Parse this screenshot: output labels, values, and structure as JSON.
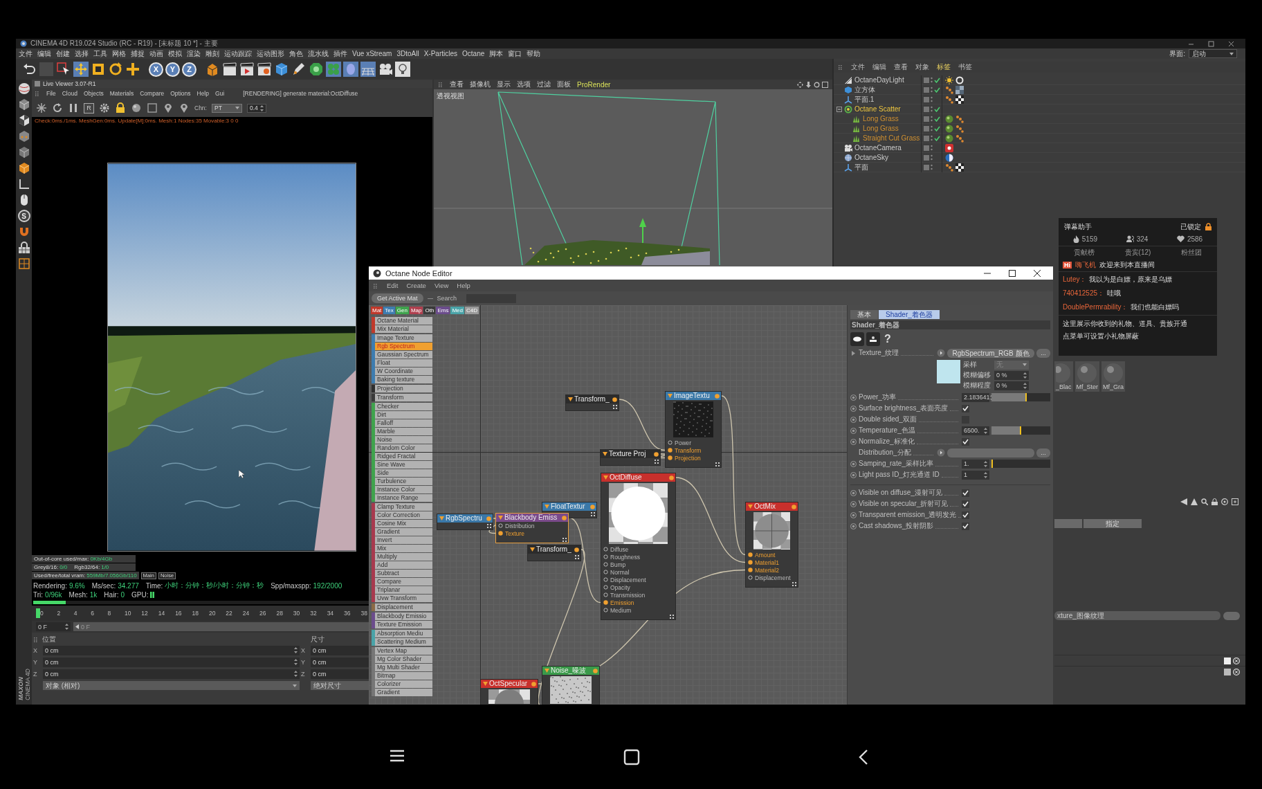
{
  "title_bar": {
    "title": "CINEMA 4D R19.024 Studio (RC - R19) - [未标题 10 *] - 主要"
  },
  "menu_bar": {
    "items": [
      "文件",
      "编辑",
      "创建",
      "选择",
      "工具",
      "网格",
      "捕捉",
      "动画",
      "模拟",
      "渲染",
      "雕刻",
      "运动跟踪",
      "运动图形",
      "角色",
      "流水线",
      "插件",
      "Vue xStream",
      "3DtoAll",
      "X-Particles",
      "Octane",
      "脚本",
      "窗口",
      "帮助"
    ],
    "layout_label": "界面:",
    "layout_value": "启动"
  },
  "toolbar": {
    "axes": [
      "X",
      "Y",
      "Z"
    ]
  },
  "tool_palette": {
    "letter": "S"
  },
  "logo": {
    "brand": "MAXON",
    "product": "CINEMA 4D"
  },
  "live_viewer": {
    "title": "Live Viewer 3.07-R1",
    "menu": [
      "File",
      "Cloud",
      "Objects",
      "Materials",
      "Compare",
      "Options",
      "Help",
      "Gui"
    ],
    "status": "[RENDERING] generate material:OctDiffuse",
    "region_button": "R",
    "channel_label": "Chn:",
    "channel": "PT",
    "value": "0.4",
    "info": "Check:0ms./1ms. MeshGen:0ms. Update[M]:0ms. Mesh:1 Nodes:35 Movable:3  0 0",
    "memory": [
      [
        {
          "label": "Out-of-core used/max:",
          "value": "0Kb/4Gb"
        }
      ],
      [
        {
          "label": "Grey8/16:",
          "value": "0/0"
        },
        {
          "label": "Rgb32/64:",
          "value": "1/0"
        }
      ],
      [
        {
          "label": "Used/free/total vram:",
          "value": "559Mb/7.056Gb/110"
        }
      ]
    ],
    "view_buttons": [
      "Main",
      "Noise"
    ],
    "render_stats": [
      {
        "kind": "text",
        "label": "Rendering:",
        "value": "9.6%"
      },
      {
        "kind": "text",
        "label": "Ms/sec:",
        "value": "34.277"
      },
      {
        "kind": "text",
        "label": "Time:",
        "value": "小时：分钟：秒/小时：分钟：秒"
      },
      {
        "kind": "text",
        "label": "Spp/maxspp:",
        "value": "192/2000"
      },
      {
        "kind": "text",
        "label": "Tri:",
        "value": "0/96k"
      },
      {
        "kind": "text",
        "label": "Mesh:",
        "value": "1k"
      },
      {
        "kind": "text",
        "label": "Hair:",
        "value": "0"
      },
      {
        "kind": "meter",
        "label": "GPU:"
      }
    ],
    "progress": {
      "level": 0.096
    }
  },
  "timeline": {
    "ticks": [
      "0",
      "2",
      "4",
      "6",
      "8",
      "10",
      "12",
      "14",
      "16",
      "18",
      "20",
      "22",
      "24",
      "26",
      "28",
      "30",
      "32",
      "34",
      "36",
      "38"
    ],
    "frame": "0 F",
    "slider": {
      "value": "0 F",
      "level": 0
    }
  },
  "coordinates": {
    "position_header": "位置",
    "size_header": "尺寸",
    "rows": [
      {
        "axis": "X",
        "position": "0 cm",
        "size_axis": "X",
        "size": "0 cm"
      },
      {
        "axis": "Y",
        "position": "0 cm",
        "size_axis": "Y",
        "size": "0 cm"
      },
      {
        "axis": "Z",
        "position": "0 cm",
        "size_axis": "Z",
        "size": "0 cm"
      }
    ],
    "mode": "对象 (相对)",
    "size_mode": "绝对尺寸"
  },
  "viewport": {
    "menu": [
      {
        "label": "查看",
        "highlighted": false
      },
      {
        "label": "摄像机",
        "highlighted": false
      },
      {
        "label": "显示",
        "highlighted": false
      },
      {
        "label": "选项",
        "highlighted": false
      },
      {
        "label": "过滤",
        "highlighted": false
      },
      {
        "label": "面板",
        "highlighted": false
      },
      {
        "label": "ProRender",
        "highlighted": true
      }
    ],
    "label": "透视视图"
  },
  "object_manager": {
    "menu": [
      {
        "label": "文件",
        "selected": false
      },
      {
        "label": "编辑",
        "selected": false
      },
      {
        "label": "查看",
        "selected": false
      },
      {
        "label": "对象",
        "selected": false
      },
      {
        "label": "标签",
        "selected": true
      },
      {
        "label": "书签",
        "selected": false
      }
    ],
    "objects": [
      {
        "name": "OctaneDayLight",
        "kind": "light",
        "selected": false,
        "enabled": true,
        "tags": [
          {
            "kind": "sun"
          },
          {
            "kind": "ring"
          }
        ]
      },
      {
        "name": "立方体",
        "kind": "cube",
        "selected": false,
        "enabled": true,
        "tags": [
          {
            "kind": "phong"
          },
          {
            "kind": "texture"
          }
        ]
      },
      {
        "name": "平面.1",
        "kind": "plane",
        "selected": false,
        "enabled": false,
        "tags": [
          {
            "kind": "phong"
          },
          {
            "kind": "checker"
          }
        ]
      },
      {
        "name": "Octane Scatter",
        "kind": "scatter",
        "selected": true,
        "enabled": true,
        "expanded": true,
        "children": [
          {
            "name": "Long Grass",
            "kind": "grass",
            "selected": false,
            "enabled": true,
            "tags": [
              {
                "kind": "material"
              },
              {
                "kind": "phong"
              }
            ]
          },
          {
            "name": "Long Grass",
            "kind": "grass",
            "selected": false,
            "enabled": true,
            "tags": [
              {
                "kind": "material"
              },
              {
                "kind": "phong"
              }
            ]
          },
          {
            "name": "Straight Cut Grass",
            "kind": "grass",
            "selected": false,
            "enabled": true,
            "tags": [
              {
                "kind": "material"
              },
              {
                "kind": "phong"
              }
            ]
          }
        ]
      },
      {
        "name": "OctaneCamera",
        "kind": "camera",
        "selected": false,
        "enabled": false,
        "tags": [
          {
            "kind": "camera"
          }
        ]
      },
      {
        "name": "OctaneSky",
        "kind": "sky",
        "selected": false,
        "enabled": false,
        "tags": [
          {
            "kind": "sky"
          }
        ]
      },
      {
        "name": "平面",
        "kind": "plane",
        "selected": false,
        "enabled": false,
        "tags": [
          {
            "kind": "phong"
          },
          {
            "kind": "checker"
          }
        ]
      }
    ]
  },
  "material_manager": {
    "materials": [
      "_Blac",
      "Mf_Ster",
      "Mf_Gra"
    ]
  },
  "attribute_manager": {
    "buttons": [
      "指定"
    ],
    "field": "xture_图像纹理"
  },
  "node_editor": {
    "title": "Octane Node Editor",
    "menu": [
      "Edit",
      "Create",
      "View",
      "Help"
    ],
    "get_active": "Get Active Mat",
    "search_label": "Search",
    "categories": [
      {
        "label": "Mat",
        "color": "#c0392b"
      },
      {
        "label": "Tex",
        "color": "#3d7cb0"
      },
      {
        "label": "Gen",
        "color": "#3fa34d"
      },
      {
        "label": "Map",
        "color": "#b0404f"
      },
      {
        "label": "Oth",
        "color": "#3a3a3a"
      },
      {
        "label": "Ems",
        "color": "#6b4c8c"
      },
      {
        "label": "Med",
        "color": "#4aa3a8"
      },
      {
        "label": "C4D",
        "color": "#9a9a9a"
      }
    ],
    "node_groups": [
      {
        "color": "#c0392b",
        "items": [
          {
            "label": "Octane Material",
            "selected": false
          },
          {
            "label": "Mix Material",
            "selected": false
          }
        ]
      },
      {
        "color": "#3d7cb0",
        "items": [
          {
            "label": "Image Texture",
            "selected": false
          },
          {
            "label": "Rgb Spectrum",
            "selected": true
          },
          {
            "label": "Gaussian Spectrum",
            "selected": false
          },
          {
            "label": "Float",
            "selected": false
          },
          {
            "label": "W Coordinate",
            "selected": false
          },
          {
            "label": "Baking texture",
            "selected": false
          }
        ]
      },
      {
        "color": "#2e2e2e",
        "items": [
          {
            "label": "Projection",
            "selected": false
          }
        ]
      },
      {
        "color": "#3a3a3a",
        "items": [
          {
            "label": "Transform",
            "selected": false
          }
        ]
      },
      {
        "color": "#3fa34d",
        "items": [
          {
            "label": "Checker",
            "selected": false
          },
          {
            "label": "Dirt",
            "selected": false
          },
          {
            "label": "Falloff",
            "selected": false
          },
          {
            "label": "Marble",
            "selected": false
          },
          {
            "label": "Noise",
            "selected": false
          },
          {
            "label": "Random Color",
            "selected": false
          },
          {
            "label": "Ridged Fractal",
            "selected": false
          },
          {
            "label": "Sine Wave",
            "selected": false
          },
          {
            "label": "Side",
            "selected": false
          },
          {
            "label": "Turbulence",
            "selected": false
          },
          {
            "label": "Instance Color",
            "selected": false
          },
          {
            "label": "Instance Range",
            "selected": false
          }
        ]
      },
      {
        "color": "#a8394e",
        "items": [
          {
            "label": "Clamp Texture",
            "selected": false
          },
          {
            "label": "Color Correction",
            "selected": false
          },
          {
            "label": "Cosine Mix",
            "selected": false
          },
          {
            "label": "Gradient",
            "selected": false
          },
          {
            "label": "Invert",
            "selected": false
          },
          {
            "label": "Mix",
            "selected": false
          },
          {
            "label": "Multiply",
            "selected": false
          },
          {
            "label": "Add",
            "selected": false
          },
          {
            "label": "Subtract",
            "selected": false
          },
          {
            "label": "Compare",
            "selected": false
          },
          {
            "label": "Triplanar",
            "selected": false
          },
          {
            "label": "Uvw Transform",
            "selected": false
          }
        ]
      },
      {
        "color": "#8b6a45",
        "items": [
          {
            "label": "Displacement",
            "selected": false
          }
        ]
      },
      {
        "color": "#6b4c8c",
        "items": [
          {
            "label": "Blackbody Emissio",
            "selected": false
          },
          {
            "label": "Texture Emission",
            "selected": false
          }
        ]
      },
      {
        "color": "#4aa3a8",
        "items": [
          {
            "label": "Absorption Mediu",
            "selected": false
          },
          {
            "label": "Scattering Medium",
            "selected": false
          }
        ]
      },
      {
        "color": "#767676",
        "items": [
          {
            "label": "Vertex Map",
            "selected": false
          },
          {
            "label": "Mg Color Shader",
            "selected": false
          },
          {
            "label": "Mg Multi Shader",
            "selected": false
          },
          {
            "label": "Bitmap",
            "selected": false
          },
          {
            "label": "Colorizer",
            "selected": false
          },
          {
            "label": "Gradient",
            "selected": false
          }
        ]
      }
    ],
    "nodes": [
      {
        "title": "Transform_",
        "color": "#2c2c2c",
        "selected": false,
        "kind": "plain"
      },
      {
        "title": "ImageTextu",
        "color": "#3a78a8",
        "selected": false,
        "kind": "noise-dark",
        "ports": [
          {
            "label": "Power",
            "connected": false
          },
          {
            "label": "Transform",
            "connected": true
          },
          {
            "label": "Projection",
            "connected": true
          }
        ]
      },
      {
        "title": "Texture Proj",
        "color": "#2c2c2c",
        "selected": false,
        "kind": "plain"
      },
      {
        "title": "OctDiffuse",
        "color": "#c8302c",
        "selected": false,
        "kind": "white-sphere",
        "ports": [
          {
            "label": "Diffuse",
            "connected": false
          },
          {
            "label": "Roughness",
            "connected": false
          },
          {
            "label": "Bump",
            "connected": false
          },
          {
            "label": "Normal",
            "connected": false
          },
          {
            "label": "Displacement",
            "connected": false
          },
          {
            "label": "Opacity",
            "connected": false
          },
          {
            "label": "Transmission",
            "connected": false
          },
          {
            "label": "Emission",
            "connected": true
          },
          {
            "label": "Medium",
            "connected": false
          }
        ]
      },
      {
        "title": "OctMix",
        "color": "#c8302c",
        "selected": false,
        "kind": "grey-sphere",
        "ports": [
          {
            "label": "Amount",
            "connected": true
          },
          {
            "label": "Material1",
            "connected": true
          },
          {
            "label": "Material2",
            "connected": true
          },
          {
            "label": "Displacement",
            "connected": false
          }
        ]
      },
      {
        "title": "RgbSpectru",
        "color": "#3a78a8",
        "selected": false,
        "kind": "plain"
      },
      {
        "title": "FloatTextur",
        "color": "#3a78a8",
        "selected": false,
        "kind": "plain"
      },
      {
        "title": "Blackbody Emiss",
        "color": "#7a4a8a",
        "selected": true,
        "kind": "plain",
        "ports": [
          {
            "label": "Distribution",
            "connected": false
          },
          {
            "label": "Texture",
            "connected": true
          }
        ]
      },
      {
        "title": "Transform_",
        "color": "#2c2c2c",
        "selected": false,
        "kind": "plain"
      },
      {
        "title": "Noise_噪波",
        "color": "#3a9a4a",
        "selected": false,
        "kind": "light-noise"
      },
      {
        "title": "OctSpecular",
        "color": "#c8302c",
        "selected": false,
        "kind": "specular-sphere"
      }
    ],
    "attributes": {
      "tabs": [
        {
          "label": "基本",
          "selected": false
        },
        {
          "label": "Shader_着色器",
          "selected": true
        }
      ],
      "section": "Shader_着色器",
      "help": "?",
      "rows": [
        {
          "kind": "link",
          "label": "Texture_纹理",
          "expandable": true,
          "value": "RgbSpectrum_RGB 颜色",
          "more": "..."
        },
        {
          "kind": "swatch",
          "color": "#bfe5ee",
          "fields": [
            {
              "kind": "dropdown",
              "label": "采样",
              "value": "无"
            },
            {
              "kind": "number",
              "label": "模糊偏移",
              "value": "0 %"
            },
            {
              "kind": "number",
              "label": "模糊程度",
              "value": "0 %"
            }
          ]
        },
        {
          "kind": "slider",
          "label": "Power_功率",
          "value": "2.183641",
          "level": 0.6
        },
        {
          "kind": "check",
          "label": "Surface brightness_表面亮度",
          "checked": true
        },
        {
          "kind": "check",
          "label": "Double sided_双面",
          "checked": false
        },
        {
          "kind": "slider",
          "label": "Temperature_色温",
          "value": "6500.",
          "level": 0.5
        },
        {
          "kind": "check",
          "label": "Normalize_标准化",
          "checked": true
        },
        {
          "kind": "link",
          "label": "Distribution_分配",
          "expandable": false,
          "more": "..."
        },
        {
          "kind": "slider",
          "label": "Samping_rate_采样比率",
          "value": "1.",
          "level": 0
        },
        {
          "kind": "number",
          "label": "Light pass ID_灯光通道 ID",
          "value": "1"
        }
      ],
      "visibility": [
        {
          "label": "Visible on diffuse_漫射可见",
          "checked": true
        },
        {
          "label": "Visible on specular_折射可见",
          "checked": true
        },
        {
          "label": "Transparent emission_透明发光",
          "checked": true
        },
        {
          "label": "Cast shadows_投射阴影",
          "checked": true
        }
      ]
    }
  },
  "chat_panel": {
    "title": "弹幕助手",
    "lock_label": "已锁定",
    "stats": [
      {
        "kind": "fire",
        "value": "5159"
      },
      {
        "kind": "viewers",
        "value": "324"
      },
      {
        "kind": "likes",
        "value": "2586"
      }
    ],
    "tabs": [
      {
        "label": "贡献榜",
        "selected": false
      },
      {
        "label": "贵宾(12)",
        "selected": false
      },
      {
        "label": "粉丝团",
        "selected": false
      }
    ],
    "welcome": {
      "badge": "Hi",
      "user": "嗨飞机",
      "text": "欢迎来到本直播间"
    },
    "messages": [
      {
        "user": "Lutey：",
        "text": "我以为是白嫖，原来是乌嫖"
      },
      {
        "user": "740412525：",
        "text": "哇哦"
      },
      {
        "user": "DoublePermrability：",
        "text": "我们也能白嫖吗"
      }
    ],
    "notice": [
      "这里展示你收到的礼物、道具、贵族开通",
      "点菜单可设置小礼物屏蔽"
    ]
  }
}
